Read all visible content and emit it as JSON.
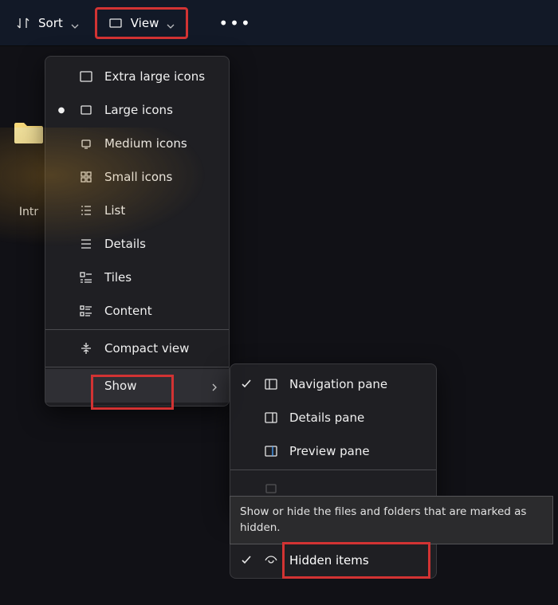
{
  "toolbar": {
    "sort_label": "Sort",
    "view_label": "View"
  },
  "folder": {
    "label": "Intr"
  },
  "view_menu": {
    "items": [
      {
        "label": "Extra large icons",
        "icon": "xlarge",
        "selected": false
      },
      {
        "label": "Large icons",
        "icon": "large",
        "selected": true
      },
      {
        "label": "Medium icons",
        "icon": "medium",
        "selected": false
      },
      {
        "label": "Small icons",
        "icon": "small",
        "selected": false
      },
      {
        "label": "List",
        "icon": "list",
        "selected": false
      },
      {
        "label": "Details",
        "icon": "details",
        "selected": false
      },
      {
        "label": "Tiles",
        "icon": "tiles",
        "selected": false
      },
      {
        "label": "Content",
        "icon": "content",
        "selected": false
      }
    ],
    "compact_label": "Compact view",
    "show_label": "Show"
  },
  "show_menu": {
    "items": [
      {
        "label": "Navigation pane",
        "icon": "nav",
        "selected": true
      },
      {
        "label": "Details pane",
        "icon": "dpane",
        "selected": false
      },
      {
        "label": "Preview pane",
        "icon": "ppane",
        "selected": false
      }
    ]
  },
  "hidden_items": {
    "label": "Hidden items",
    "selected": true
  },
  "tooltip": "Show or hide the files and folders that are marked as hidden."
}
